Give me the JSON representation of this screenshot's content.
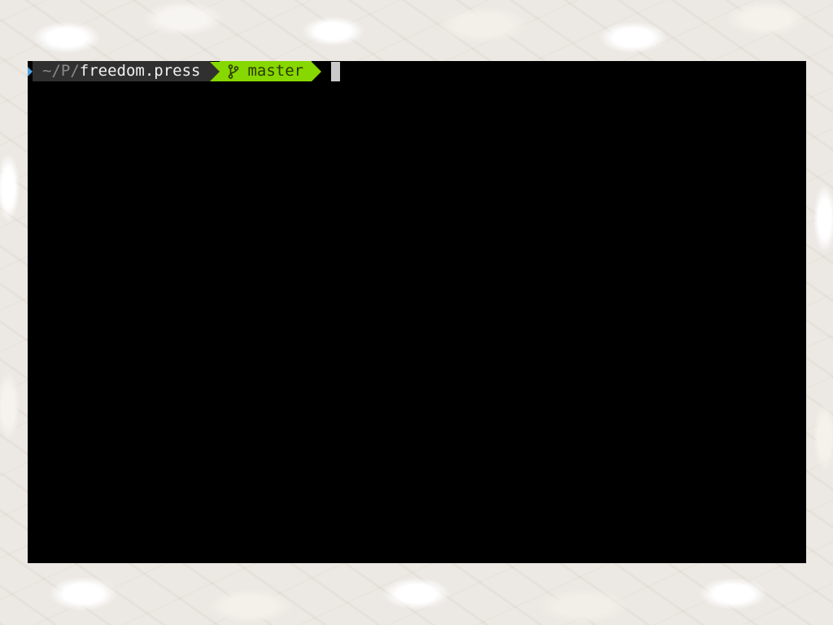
{
  "terminal": {
    "prompt": {
      "path_prefix": "~/P/",
      "path_current": "freedom.press",
      "git_branch_icon": "git-branch-icon",
      "git_branch": "master"
    }
  },
  "colors": {
    "terminal_background": "#000000",
    "path_segment": "#303030",
    "git_segment": "#87d700",
    "status_indicator": "#4fa3e0",
    "cursor": "#c9c9c9"
  }
}
